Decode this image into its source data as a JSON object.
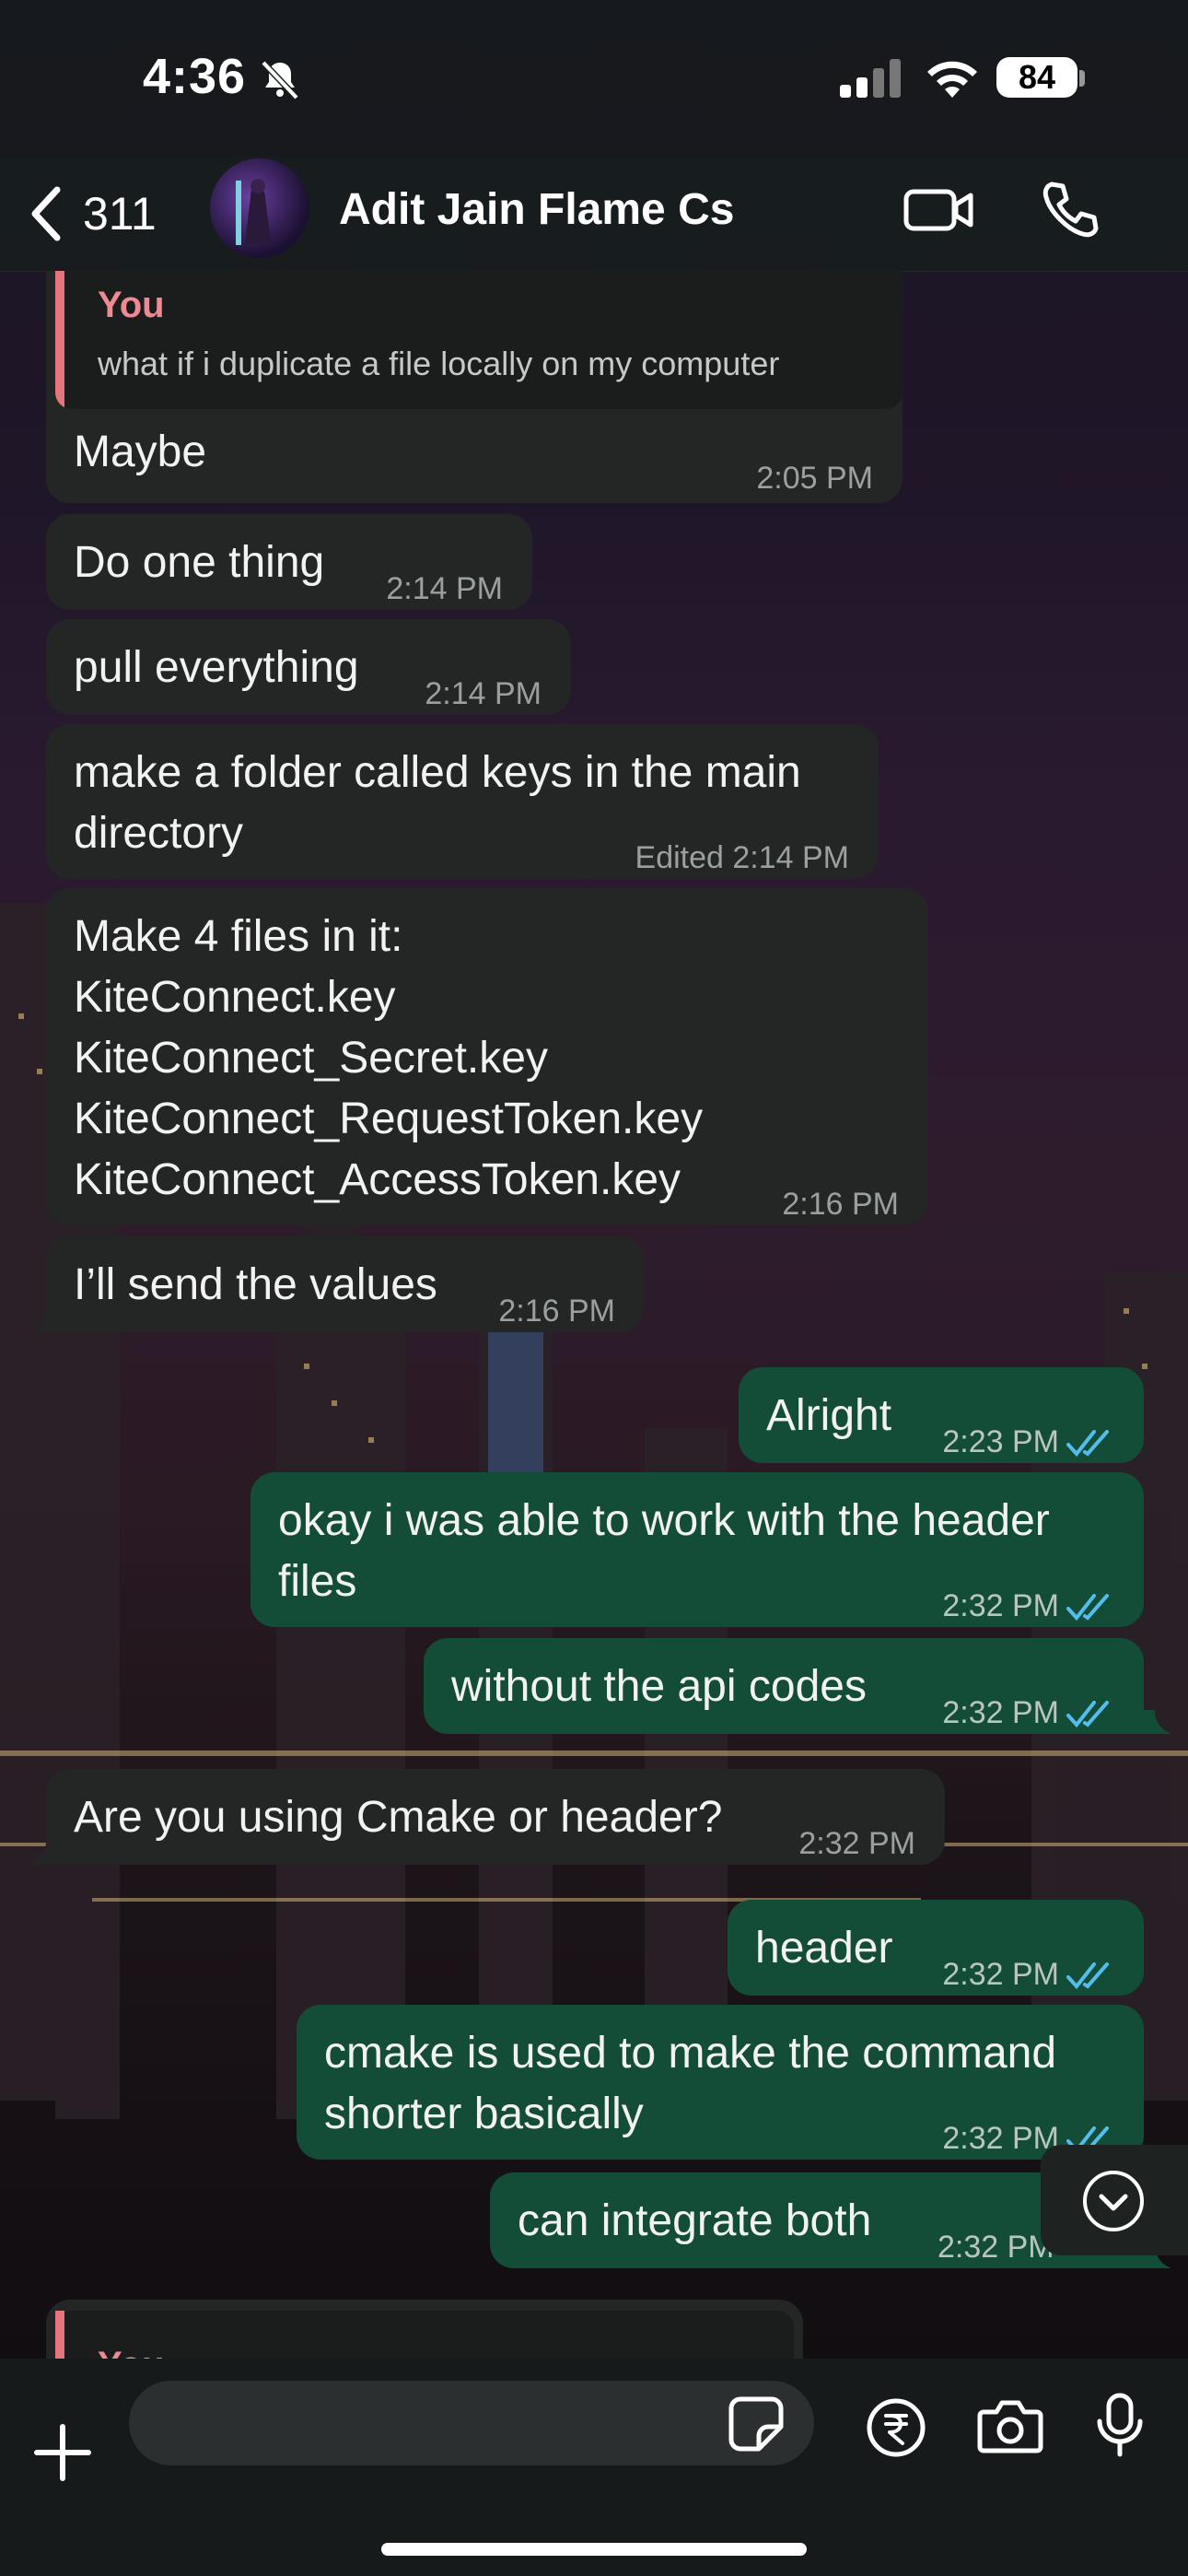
{
  "status_bar": {
    "time": "4:36",
    "battery": "84"
  },
  "header": {
    "back_count": "311",
    "contact_name": "Adit Jain Flame Cs"
  },
  "quoted": {
    "author": "You",
    "text": "what if i duplicate a file locally on my computer"
  },
  "messages": [
    {
      "text": "Maybe",
      "time": "2:05 PM"
    },
    {
      "text": "Do one thing",
      "time": "2:14 PM"
    },
    {
      "text": "pull everything",
      "time": "2:14 PM"
    },
    {
      "text": "make a folder called keys in the main\ndirectory",
      "time": "Edited 2:14 PM"
    },
    {
      "text": "Make 4 files in it:\nKiteConnect.key\nKiteConnect_Secret.key\nKiteConnect_RequestToken.key\nKiteConnect_AccessToken.key",
      "time": "2:16 PM"
    },
    {
      "text": "I’ll send the values",
      "time": "2:16 PM"
    },
    {
      "text": "Alright",
      "time": "2:23 PM"
    },
    {
      "text": "okay i was able to work with the header\nfiles",
      "time": "2:32 PM"
    },
    {
      "text": "without the api codes",
      "time": "2:32 PM"
    },
    {
      "text": "Are you using Cmake or header?",
      "time": "2:32 PM"
    },
    {
      "text": "header",
      "time": "2:32 PM"
    },
    {
      "text": "cmake is used to make the command\nshorter basically",
      "time": "2:32 PM"
    },
    {
      "text": "can integrate both",
      "time": "2:32 PM"
    }
  ],
  "bottom_quote": {
    "author": "You"
  },
  "input": {
    "placeholder": ""
  },
  "colors": {
    "incoming": "#242626",
    "outgoing": "#144d37",
    "read_ticks": "#53bdeb",
    "quote_bar": "#e5747d"
  }
}
